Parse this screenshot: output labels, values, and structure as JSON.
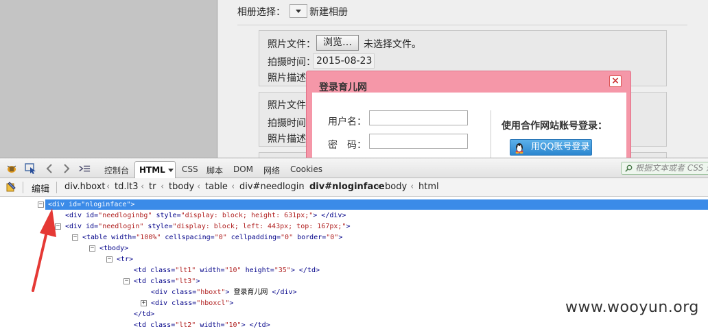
{
  "page": {
    "album_label": "相册选择：",
    "new_album": "新建相册",
    "photo_file_label": "照片文件：",
    "browse_button": "浏览…",
    "no_file": "未选择文件。",
    "shoot_time_label": "拍摄时间：",
    "shoot_date": "2015-08-23",
    "photo_desc_label": "照片描述",
    "photo_file_label_2": "照片文件",
    "shoot_time_label_2": "拍摄时间",
    "photo_desc_label_2": "照片描述"
  },
  "login": {
    "title": "登录育儿网",
    "close": "×",
    "username_label": "用户名：",
    "password_label": "密　码：",
    "partner_title": "使用合作网站账号登录：",
    "qq_button": "用QQ账号登录"
  },
  "firebug": {
    "tabs": [
      "控制台",
      "HTML",
      "CSS",
      "脚本",
      "DOM",
      "网络",
      "Cookies"
    ],
    "search_placeholder": "根据文本或者 CSS 选",
    "edit_label": "编辑",
    "breadcrumb": [
      "div.hboxt",
      "td.lt3",
      "tr",
      "tbody",
      "table",
      "div#needlogin",
      "div#nloginface",
      "body",
      "html"
    ],
    "tree": [
      {
        "indent": 0,
        "toggle": "−",
        "parts": [
          [
            "tg",
            "<div "
          ],
          [
            "an",
            "id="
          ],
          [
            "av",
            "\"nloginface\""
          ],
          [
            "tg",
            ">"
          ]
        ]
      },
      {
        "indent": 1,
        "toggle": "",
        "parts": [
          [
            "tg",
            "<div "
          ],
          [
            "an",
            "id="
          ],
          [
            "av",
            "\"needloginbg\""
          ],
          [
            "an",
            " style="
          ],
          [
            "av",
            "\"display: block; height: 631px;\""
          ],
          [
            "tg",
            "> </div>"
          ]
        ]
      },
      {
        "indent": 1,
        "toggle": "−",
        "parts": [
          [
            "tg",
            "<div "
          ],
          [
            "an",
            "id="
          ],
          [
            "av",
            "\"needlogin\""
          ],
          [
            "an",
            " style="
          ],
          [
            "av",
            "\"display: block; left: 443px; top: 167px;\""
          ],
          [
            "tg",
            ">"
          ]
        ]
      },
      {
        "indent": 2,
        "toggle": "−",
        "parts": [
          [
            "tg",
            "<table "
          ],
          [
            "an",
            "width="
          ],
          [
            "av",
            "\"100%\""
          ],
          [
            "an",
            " cellspacing="
          ],
          [
            "av",
            "\"0\""
          ],
          [
            "an",
            " cellpadding="
          ],
          [
            "av",
            "\"0\""
          ],
          [
            "an",
            " border="
          ],
          [
            "av",
            "\"0\""
          ],
          [
            "tg",
            ">"
          ]
        ]
      },
      {
        "indent": 3,
        "toggle": "−",
        "parts": [
          [
            "tg",
            "<tbody>"
          ]
        ]
      },
      {
        "indent": 4,
        "toggle": "−",
        "parts": [
          [
            "tg",
            "<tr>"
          ]
        ]
      },
      {
        "indent": 5,
        "toggle": "",
        "parts": [
          [
            "tg",
            "<td "
          ],
          [
            "an",
            "class="
          ],
          [
            "av",
            "\"lt1\""
          ],
          [
            "an",
            " width="
          ],
          [
            "av",
            "\"10\""
          ],
          [
            "an",
            " height="
          ],
          [
            "av",
            "\"35\""
          ],
          [
            "tg",
            "> </td>"
          ]
        ]
      },
      {
        "indent": 5,
        "toggle": "−",
        "parts": [
          [
            "tg",
            "<td "
          ],
          [
            "an",
            "class="
          ],
          [
            "av",
            "\"lt3\""
          ],
          [
            "tg",
            ">"
          ]
        ]
      },
      {
        "indent": 6,
        "toggle": "",
        "parts": [
          [
            "tg",
            "<div "
          ],
          [
            "an",
            "class="
          ],
          [
            "av",
            "\"hboxt\""
          ],
          [
            "tg",
            "> "
          ],
          [
            "tx",
            "登录育儿网"
          ],
          [
            "tg",
            " </div>"
          ]
        ]
      },
      {
        "indent": 6,
        "toggle": "+",
        "parts": [
          [
            "tg",
            "<div "
          ],
          [
            "an",
            "class="
          ],
          [
            "av",
            "\"hboxcl\""
          ],
          [
            "tg",
            ">"
          ]
        ]
      },
      {
        "indent": 5,
        "toggle": "",
        "parts": [
          [
            "tg",
            "</td>"
          ]
        ]
      },
      {
        "indent": 5,
        "toggle": "",
        "parts": [
          [
            "tg",
            "<td "
          ],
          [
            "an",
            "class="
          ],
          [
            "av",
            "\"lt2\""
          ],
          [
            "an",
            " width="
          ],
          [
            "av",
            "\"10\""
          ],
          [
            "tg",
            "> </td>"
          ]
        ]
      }
    ]
  },
  "watermark": "www.wooyun.org",
  "colors": {
    "dialog": "#f597a8",
    "selection": "#3b8be8",
    "arrow": "#e53935"
  }
}
